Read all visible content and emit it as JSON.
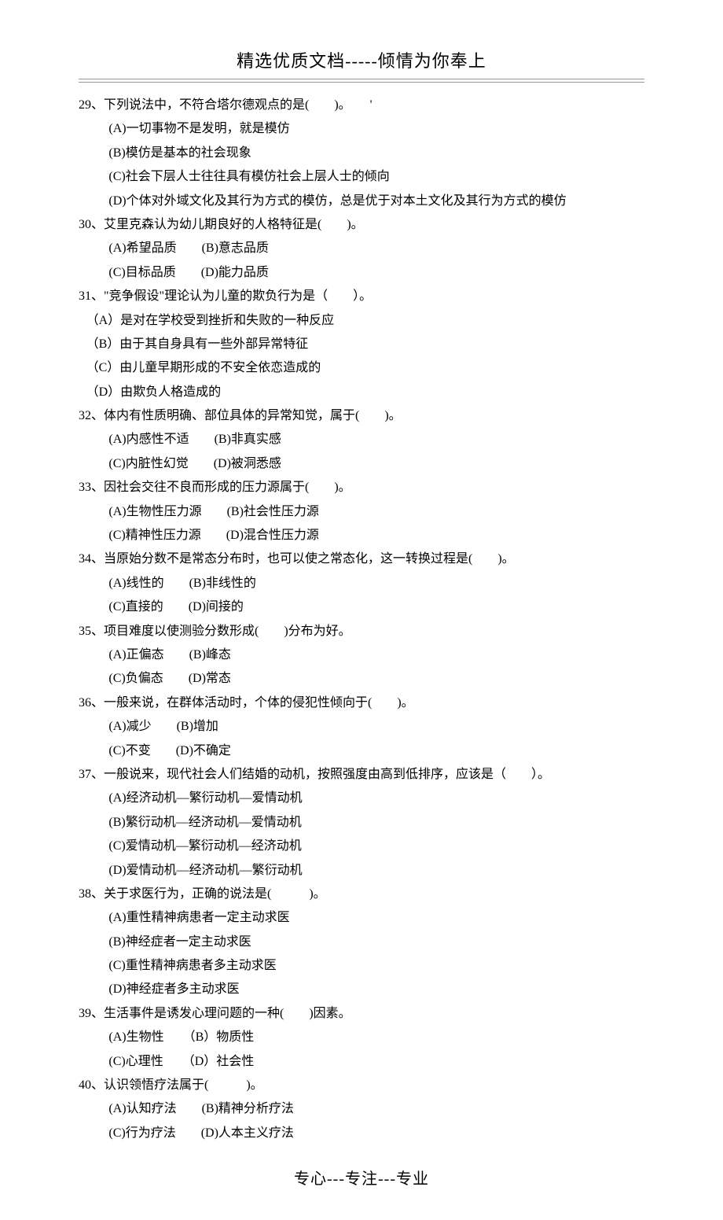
{
  "header": "精选优质文档-----倾情为你奉上",
  "footer": "专心---专注---专业",
  "questions": [
    {
      "num": "29",
      "stem": "下列说法中，不符合塔尔德观点的是(　　)。　　'",
      "opts": [
        "(A)一切事物不是发明，就是模仿",
        "(B)模仿是基本的社会现象",
        "(C)社会下层人士往往具有模仿社会上层人士的倾向",
        "(D)个体对外域文化及其行为方式的模仿，总是优于对本土文化及其行为方式的模仿"
      ]
    },
    {
      "num": "30",
      "stem": "艾里克森认为幼儿期良好的人格特征是(　　)。",
      "opts": [
        "(A)希望品质　　(B)意志品质",
        "(C)目标品质　　(D)能力品质"
      ]
    },
    {
      "num": "31",
      "stem": "\"竞争假设\"理论认为儿童的欺负行为是（　　）。",
      "noindent": true,
      "opts": [
        "（A）是对在学校受到挫折和失败的一种反应",
        "（B）由于其自身具有一些外部异常特征",
        "（C）由儿童早期形成的不安全依恋造成的",
        "（D）由欺负人格造成的"
      ]
    },
    {
      "num": "32",
      "stem": "体内有性质明确、部位具体的异常知觉，属于(　　)。",
      "opts": [
        "(A)内感性不适　　(B)非真实感",
        "(C)内脏性幻觉　　(D)被洞悉感"
      ]
    },
    {
      "num": "33",
      "stem": "因社会交往不良而形成的压力源属于(　　)。",
      "opts": [
        "(A)生物性压力源　　(B)社会性压力源",
        "(C)精神性压力源　　(D)混合性压力源"
      ]
    },
    {
      "num": "34",
      "stem": "当原始分数不是常态分布时，也可以使之常态化，这一转换过程是(　　)。",
      "opts": [
        "(A)线性的　　(B)非线性的",
        "(C)直接的　　(D)间接的"
      ]
    },
    {
      "num": "35",
      "stem": "项目难度以使测验分数形成(　　)分布为好。",
      "opts": [
        "(A)正偏态　　(B)峰态",
        "(C)负偏态　　(D)常态"
      ]
    },
    {
      "num": "36",
      "stem": "一般来说，在群体活动时，个体的侵犯性倾向于(　　)。",
      "opts": [
        "(A)减少　　(B)增加",
        "(C)不变　　(D)不确定"
      ]
    },
    {
      "num": "37",
      "stem": "一般说来，现代社会人们结婚的动机，按照强度由高到低排序，应该是（　　）。",
      "opts": [
        "(A)经济动机—繁衍动机—爱情动机",
        "(B)繁衍动机—经济动机—爱情动机",
        "(C)爱情动机—繁衍动机—经济动机",
        "(D)爱情动机—经济动机—繁衍动机"
      ]
    },
    {
      "num": "38",
      "stem": "关于求医行为，正确的说法是(　　　)。",
      "opts": [
        "(A)重性精神病患者一定主动求医",
        "(B)神经症者一定主动求医",
        "(C)重性精神病患者多主动求医",
        "(D)神经症者多主动求医"
      ]
    },
    {
      "num": "39",
      "stem": "生活事件是诱发心理问题的一种(　　)因素。",
      "opts": [
        "(A)生物性　　（B）物质性",
        "(C)心理性　　（D）社会性"
      ]
    },
    {
      "num": "40",
      "stem": "认识领悟疗法属于(　　　)。",
      "opts": [
        "(A)认知疗法　　(B)精神分析疗法",
        "(C)行为疗法　　(D)人本主义疗法"
      ]
    }
  ]
}
